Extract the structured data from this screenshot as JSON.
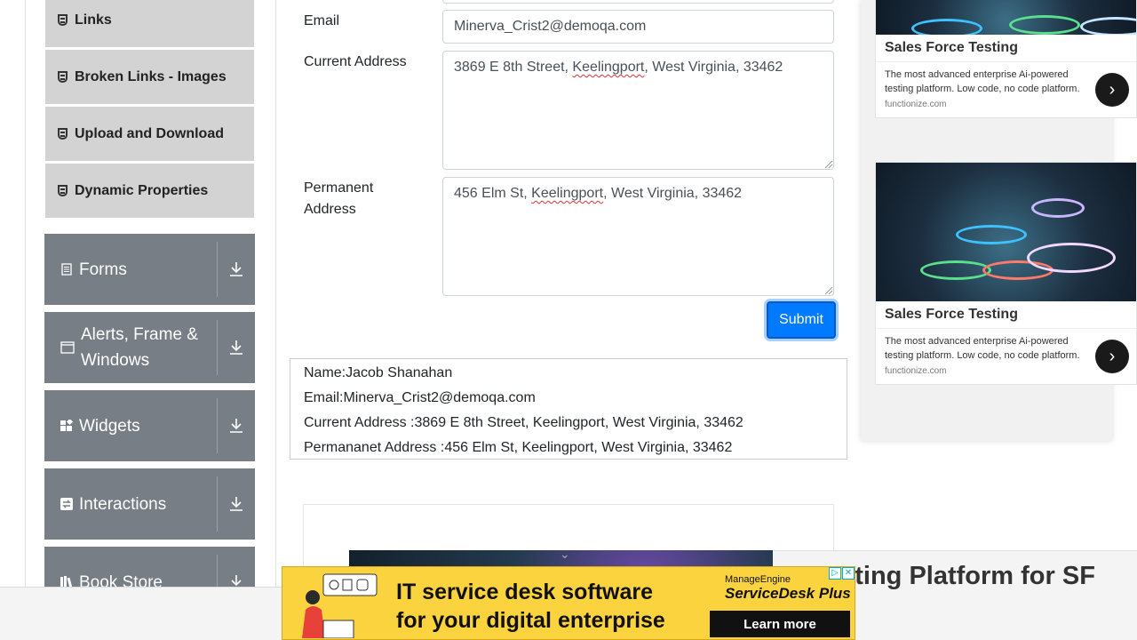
{
  "sidebar": {
    "sub_items": [
      {
        "label": "Links"
      },
      {
        "label": "Broken Links - Images"
      },
      {
        "label": "Upload and Download"
      },
      {
        "label": "Dynamic Properties"
      }
    ],
    "groups": [
      {
        "label": "Forms",
        "icon": "document-icon"
      },
      {
        "label": "Alerts, Frame & Windows",
        "icon": "window-icon"
      },
      {
        "label": "Widgets",
        "icon": "widgets-icon"
      },
      {
        "label": "Interactions",
        "icon": "interactions-icon"
      },
      {
        "label": "Book Store",
        "icon": "books-icon"
      }
    ]
  },
  "form": {
    "email_label": "Email",
    "email_value": "Minerva_Crist2@demoqa.com",
    "current_address_label": "Current Address",
    "current_address": {
      "pre": "3869 E 8th Street, ",
      "misspelled": "Keelingport",
      "post": ", West Virginia, 33462"
    },
    "permanent_address_label": "Permanent Address",
    "permanent_address": {
      "pre": "456 Elm St, ",
      "misspelled": "Keelingport",
      "post": ", West Virginia, 33462"
    },
    "submit_label": "Submit"
  },
  "output": {
    "name": "Name:Jacob Shanahan",
    "email": "Email:Minerva_Crist2@demoqa.com",
    "current_address": "Current Address :3869 E 8th Street, Keelingport, West Virginia, 33462",
    "permanent_address": "Permananet Address :456 Elm St, Keelingport, West Virginia, 33462"
  },
  "ads": {
    "card1": {
      "title": "Sales Force Testing",
      "body": "The most advanced enterprise Ai-powered testing platform. Low code, no code platform.",
      "domain": "functionize.com"
    },
    "card2": {
      "title": "Sales Force Testing",
      "body": "The most advanced enterprise Ai-powered testing platform. Low code, no code platform.",
      "domain": "functionize.com"
    },
    "lower_title": "esting Platform for SF",
    "banner": {
      "line1": "IT service desk software",
      "line2": "for your digital enterprise",
      "brand_small": "ManageEngine",
      "brand": "ServiceDesk Plus",
      "cta": "Learn more"
    }
  },
  "colors": {
    "primary": "#007bff",
    "sidebar_group": "#777e86",
    "sidebar_sub": "#d3d3d3",
    "banner": "#fbd33e"
  }
}
